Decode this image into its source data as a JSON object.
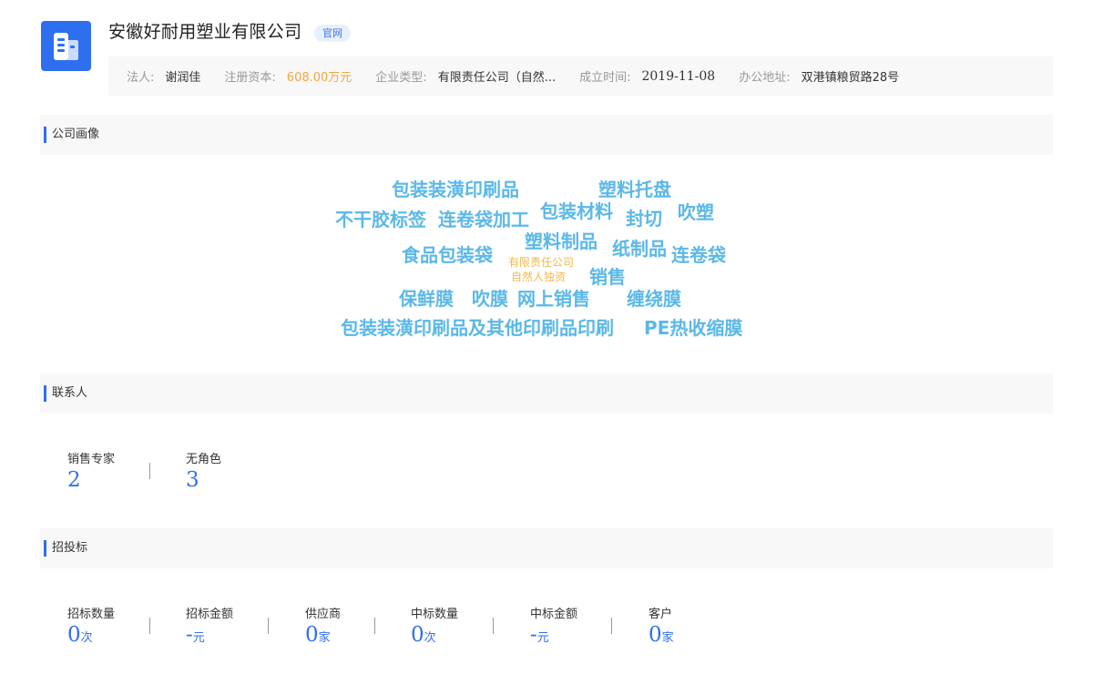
{
  "company": {
    "name": "安徽好耐用塑业有限公司",
    "badge": "官网"
  },
  "info": [
    {
      "label": "法人:",
      "value": "谢润佳"
    },
    {
      "label": "注册资本:",
      "value": "608.00万元"
    },
    {
      "label": "企业类型:",
      "value": "有限责任公司（自然..."
    },
    {
      "label": "成立时间:",
      "value": "2019-11-08"
    },
    {
      "label": "办公地址:",
      "value": "双港镇粮贸路28号"
    }
  ],
  "colors": {
    "accent": "#2e6ff0",
    "capital": "#f2a640",
    "keyword": "#5bb8e8",
    "keyword_minor": "#f2b84b"
  },
  "profile": {
    "title": "公司画像",
    "keywords": [
      "包装装潢印刷品",
      "塑料托盘",
      "不干胶标签",
      "连卷袋加工",
      "包装材料",
      "封切",
      "吹塑",
      "食品包装袋",
      "塑料制品",
      "纸制品",
      "连卷袋",
      "有限责任公司",
      "自然人独资",
      "销售",
      "保鲜膜",
      "吹膜",
      "网上销售",
      "缠绕膜",
      "包装装潢印刷品及其他印刷品印刷",
      "PE热收缩膜"
    ]
  },
  "contacts": {
    "title": "联系人",
    "stats": [
      {
        "label": "销售专家",
        "value": "2",
        "unit": ""
      },
      {
        "label": "无角色",
        "value": "3",
        "unit": ""
      }
    ]
  },
  "bidding": {
    "title": "招投标",
    "stats": [
      {
        "label": "招标数量",
        "value": "0",
        "unit": "次"
      },
      {
        "label": "招标金额",
        "value": "-",
        "unit": "元"
      },
      {
        "label": "供应商",
        "value": "0",
        "unit": "家"
      },
      {
        "label": "中标数量",
        "value": "0",
        "unit": "次"
      },
      {
        "label": "中标金额",
        "value": "-",
        "unit": "元"
      },
      {
        "label": "客户",
        "value": "0",
        "unit": "家"
      }
    ]
  }
}
